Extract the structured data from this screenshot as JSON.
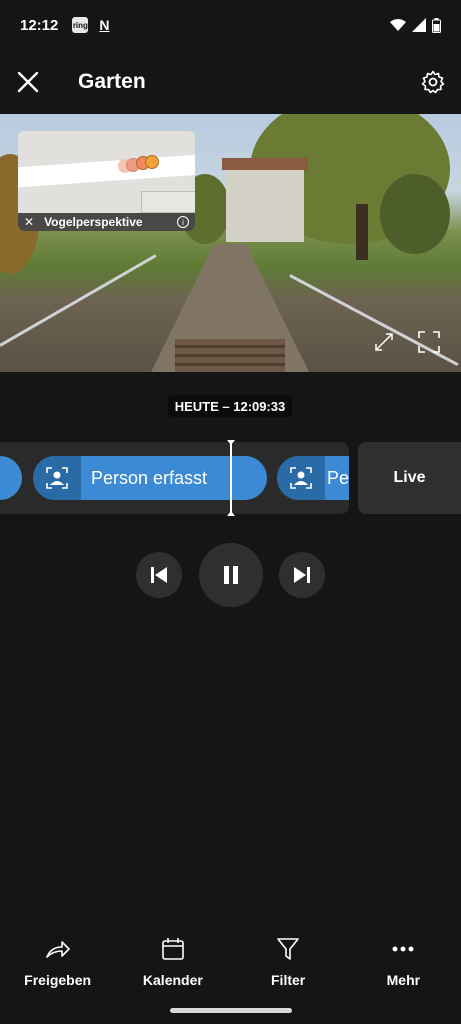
{
  "status_bar": {
    "time": "12:12",
    "app_icons": [
      "ring",
      "N"
    ]
  },
  "header": {
    "title": "Garten",
    "close_icon": "close-icon",
    "settings_icon": "gear-icon"
  },
  "video": {
    "birdseye_label": "Vogelperspektive",
    "birdseye_close": "✕",
    "birdseye_info": "i"
  },
  "timestamp": "HEUTE – 12:09:33",
  "timeline": {
    "events": [
      {
        "label": "Person erfasst"
      },
      {
        "label": "Per"
      }
    ],
    "live_label": "Live"
  },
  "bottom_nav": {
    "items": [
      {
        "label": "Freigeben",
        "icon": "share-icon"
      },
      {
        "label": "Kalender",
        "icon": "calendar-icon"
      },
      {
        "label": "Filter",
        "icon": "filter-icon"
      },
      {
        "label": "Mehr",
        "icon": "more-icon"
      }
    ]
  },
  "colors": {
    "background": "#151515",
    "event_blue": "#3c8ad4",
    "event_icon_blue": "#2a6aa6"
  }
}
